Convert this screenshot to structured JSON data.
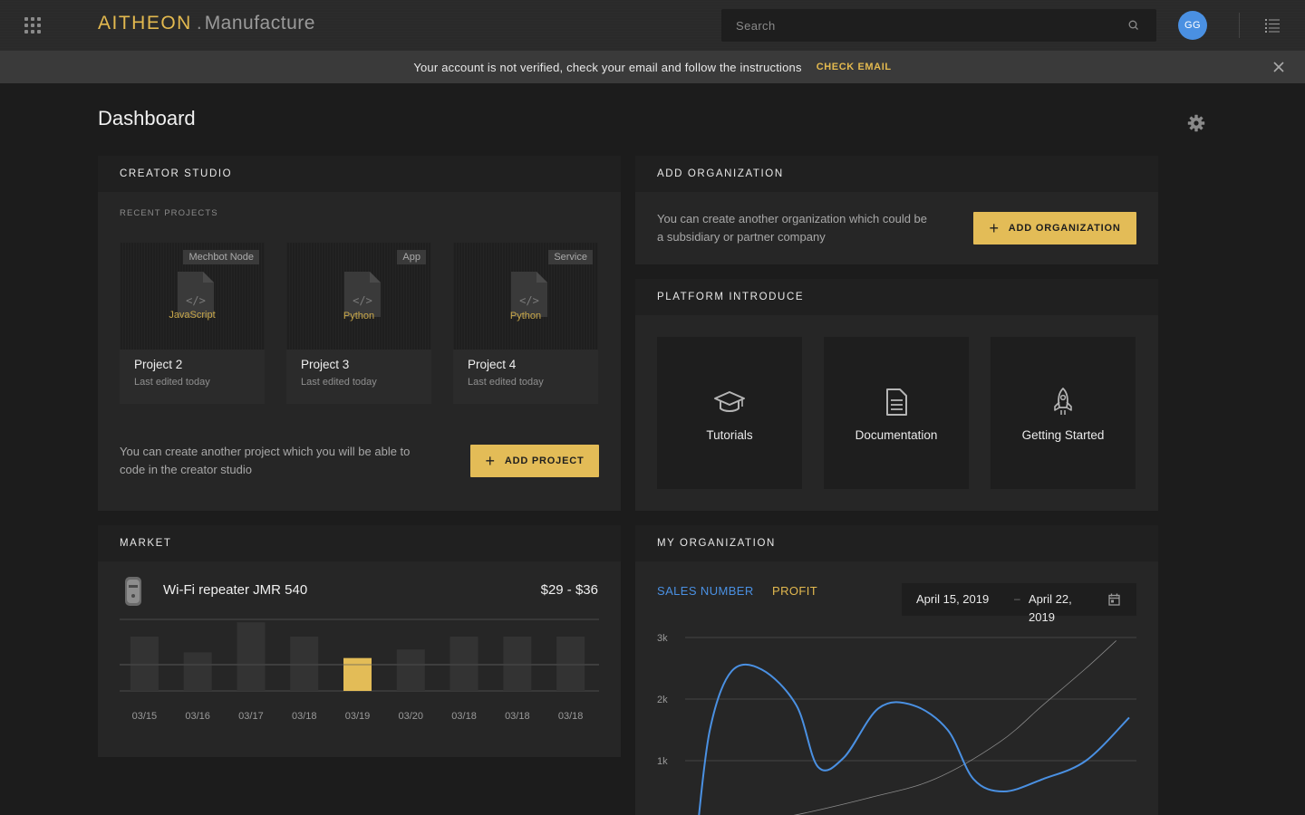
{
  "header": {
    "brand_name": "AITHEON",
    "brand_separator": ".",
    "product_name": "Manufacture",
    "search_placeholder": "Search",
    "avatar_initials": "GG"
  },
  "banner": {
    "message": "Your account is not verified, check your email and follow the instructions",
    "link_label": "CHECK EMAIL"
  },
  "page": {
    "title": "Dashboard"
  },
  "creator_studio": {
    "title": "CREATOR STUDIO",
    "section_label": "RECENT PROJECTS",
    "projects": [
      {
        "tag": "Mechbot Node",
        "language": "JavaScript",
        "name": "Project 2",
        "meta": "Last edited today"
      },
      {
        "tag": "App",
        "language": "Python",
        "name": "Project 3",
        "meta": "Last edited today"
      },
      {
        "tag": "Service",
        "language": "Python",
        "name": "Project 4",
        "meta": "Last edited today"
      }
    ],
    "description": "You can create another project which you will be able to code in the creator studio",
    "add_button": "ADD PROJECT"
  },
  "add_organization": {
    "title": "ADD ORGANIZATION",
    "description": "You can create another organization which could be a subsidiary or partner company",
    "button": "ADD ORGANIZATION"
  },
  "platform": {
    "title": "PLATFORM INTRODUCE",
    "tiles": [
      {
        "label": "Tutorials",
        "icon": "graduation-cap-icon"
      },
      {
        "label": "Documentation",
        "icon": "document-icon"
      },
      {
        "label": "Getting Started",
        "icon": "rocket-icon"
      }
    ]
  },
  "market": {
    "title": "MARKET",
    "product_name": "Wi-Fi repeater JMR 540",
    "price": "$29 - $36"
  },
  "my_organization": {
    "title": "MY ORGANIZATION",
    "tab_sales": "SALES NUMBER",
    "tab_profit": "PROFIT",
    "date_start": "April 15, 2019",
    "date_separator": "–",
    "date_end": "April 22, 2019"
  },
  "colors": {
    "accent_gold": "#e3bc57",
    "sales_blue": "#4a90e2",
    "bar_gray": "#333333",
    "avatar_blue": "#4a90e2"
  },
  "chart_data": [
    {
      "type": "bar",
      "categories": [
        "03/15",
        "03/16",
        "03/17",
        "03/18",
        "03/19",
        "03/20",
        "03/18",
        "03/18",
        "03/18"
      ],
      "values": [
        76,
        54,
        96,
        76,
        46,
        58,
        76,
        76,
        76
      ],
      "highlight_index": 4,
      "ylim": [
        0,
        100
      ],
      "grid": true
    },
    {
      "type": "line",
      "ylabel_ticks": [
        "3k",
        "2k",
        "1k"
      ],
      "yticks": [
        3000,
        2000,
        1000
      ],
      "ylim": [
        0,
        3000
      ],
      "xlim": [
        0,
        1
      ],
      "grid": true,
      "series": [
        {
          "x": [
            0,
            0.03,
            0.08,
            0.15,
            0.23,
            0.28,
            0.34,
            0.42,
            0.5,
            0.58,
            0.64,
            0.71,
            0.8,
            0.9,
            1.0
          ],
          "y": [
            -200,
            1500,
            2450,
            2480,
            1900,
            900,
            1050,
            1850,
            1900,
            1500,
            700,
            500,
            700,
            1000,
            1700
          ]
        },
        {
          "x": [
            0,
            0.2,
            0.4,
            0.55,
            0.7,
            0.8,
            0.9,
            0.97
          ],
          "y": [
            -100,
            80,
            400,
            700,
            1300,
            1900,
            2500,
            2950
          ]
        }
      ]
    }
  ]
}
